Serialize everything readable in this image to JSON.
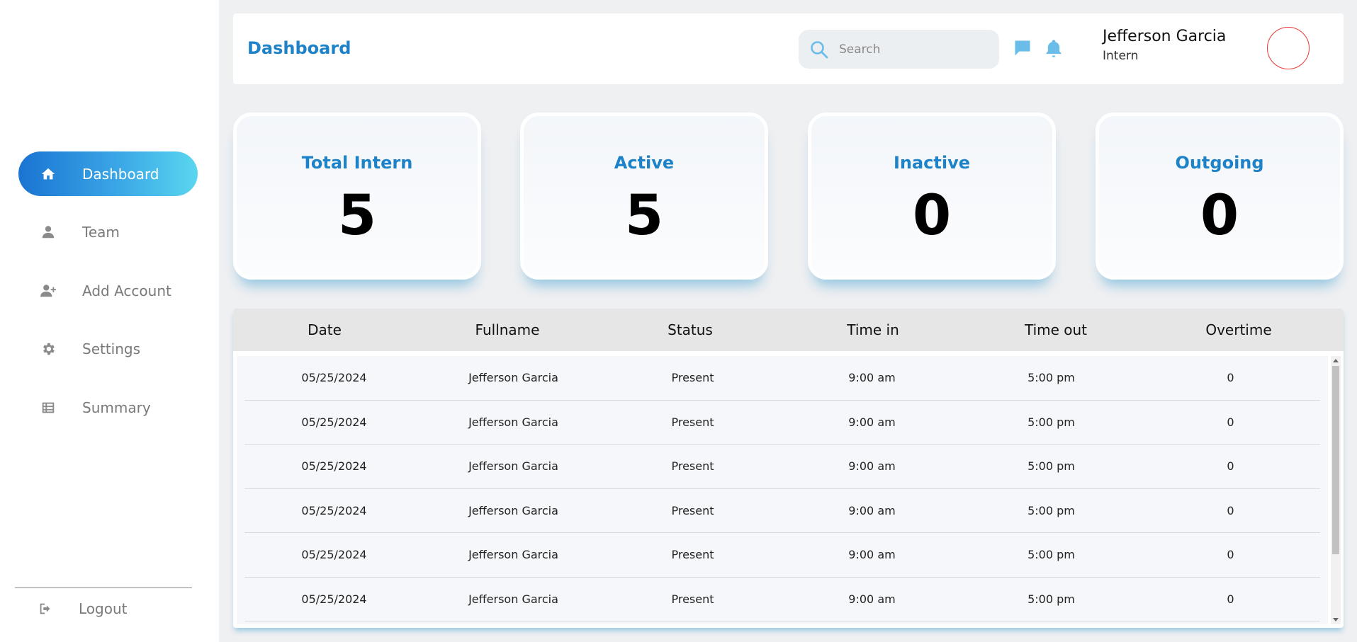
{
  "sidebar": {
    "items": [
      {
        "label": "Dashboard",
        "icon": "home-icon",
        "active": true
      },
      {
        "label": "Team",
        "icon": "user-icon",
        "active": false
      },
      {
        "label": "Add Account",
        "icon": "user-plus-icon",
        "active": false
      },
      {
        "label": "Settings",
        "icon": "gear-icon",
        "active": false
      },
      {
        "label": "Summary",
        "icon": "table-icon",
        "active": false
      }
    ],
    "logout_label": "Logout",
    "accent_gradient": [
      "#1a74d2",
      "#5ad6ef"
    ]
  },
  "header": {
    "title": "Dashboard",
    "search_placeholder": "Search",
    "user_name": "Jefferson Garcia",
    "user_role": "Intern"
  },
  "stats": [
    {
      "label": "Total Intern",
      "value": "5"
    },
    {
      "label": "Active",
      "value": "5"
    },
    {
      "label": "Inactive",
      "value": "0"
    },
    {
      "label": "Outgoing",
      "value": "0"
    }
  ],
  "table": {
    "columns": [
      "Date",
      "Fullname",
      "Status",
      "Time in",
      "Time out",
      "Overtime"
    ],
    "rows": [
      [
        "05/25/2024",
        "Jefferson Garcia",
        "Present",
        "9:00 am",
        "5:00 pm",
        "0"
      ],
      [
        "05/25/2024",
        "Jefferson Garcia",
        "Present",
        "9:00 am",
        "5:00 pm",
        "0"
      ],
      [
        "05/25/2024",
        "Jefferson Garcia",
        "Present",
        "9:00 am",
        "5:00 pm",
        "0"
      ],
      [
        "05/25/2024",
        "Jefferson Garcia",
        "Present",
        "9:00 am",
        "5:00 pm",
        "0"
      ],
      [
        "05/25/2024",
        "Jefferson Garcia",
        "Present",
        "9:00 am",
        "5:00 pm",
        "0"
      ],
      [
        "05/25/2024",
        "Jefferson Garcia",
        "Present",
        "9:00 am",
        "5:00 pm",
        "0"
      ]
    ]
  },
  "colors": {
    "accent": "#1d82c8",
    "icon_blue": "#6bbde9",
    "avatar_border": "#e53935"
  }
}
